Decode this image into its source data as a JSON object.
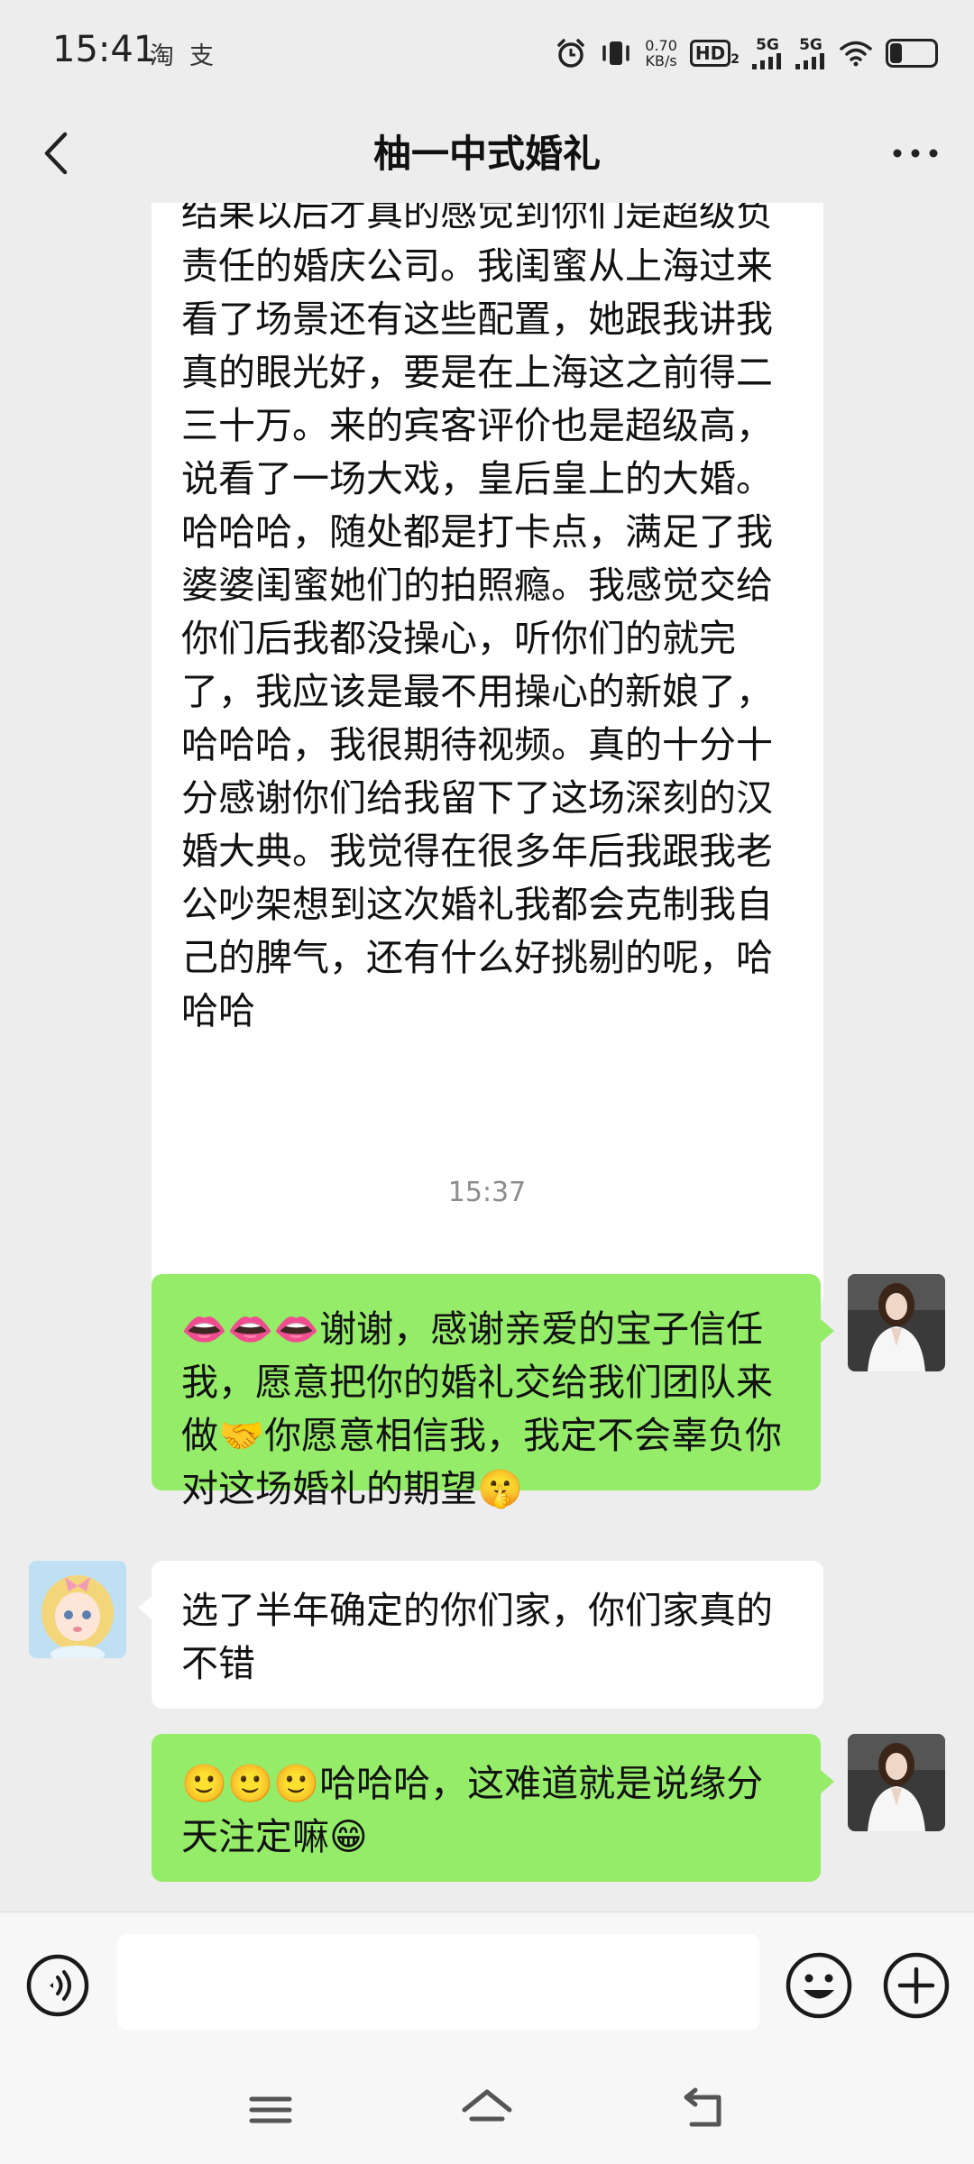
{
  "status_bar": {
    "time": "15:41",
    "app_icon_1": "淘",
    "app_icon_2": "支",
    "speed_value": "0.70",
    "speed_unit": "KB/s",
    "hd_label": "HD",
    "hd_sub": "2",
    "sim1_label": "5G",
    "sim2_label": "5G",
    "battery_level": 0.3,
    "icons": [
      "alarm-icon",
      "vibrate-icon",
      "signal-icon",
      "wifi-icon",
      "battery-icon"
    ]
  },
  "header": {
    "title": "柚一中式婚礼",
    "back_icon": "chevron-left-icon",
    "more_icon": "more-dots-icon"
  },
  "messages": [
    {
      "side": "left",
      "text": "结果以后才真的感觉到你们是超级负责任的婚庆公司。我闺蜜从上海过来看了场景还有这些配置，她跟我讲我真的眼光好，要是在上海这之前得二三十万。来的宾客评价也是超级高，说看了一场大戏，皇后皇上的大婚。哈哈哈，随处都是打卡点，满足了我婆婆闺蜜她们的拍照瘾。我感觉交给你们后我都没操心，听你们的就完了，我应该是最不用操心的新娘了，哈哈哈，我很期待视频。真的十分十分感谢你们给我留下了这场深刻的汉婚大典。我觉得在很多年后我跟我老公吵架想到这次婚礼我都会克制我自己的脾气，还有什么好挑剔的呢，哈哈哈"
    },
    {
      "type": "timestamp",
      "text": "15:37"
    },
    {
      "side": "right",
      "text": "👄👄👄谢谢，感谢亲爱的宝子信任我，愿意把你的婚礼交给我们团队来做🤝你愿意相信我，我定不会辜负你对这场婚礼的期望🤫"
    },
    {
      "side": "left",
      "text": "选了半年确定的你们家，你们家真的不错"
    },
    {
      "side": "right",
      "text": "🙂🙂🙂哈哈哈，这难道就是说缘分天注定嘛😁"
    }
  ],
  "input_bar": {
    "voice_icon": "voice-icon",
    "input_value": "",
    "emoji_icon": "emoji-icon",
    "plus_icon": "plus-icon"
  },
  "nav_bar": {
    "icons": [
      "menu-icon",
      "home-icon",
      "back-icon"
    ]
  },
  "colors": {
    "background": "#ededed",
    "bubble_self": "#95ec69",
    "bubble_other": "#ffffff",
    "timestamp": "#8c8c8c"
  }
}
